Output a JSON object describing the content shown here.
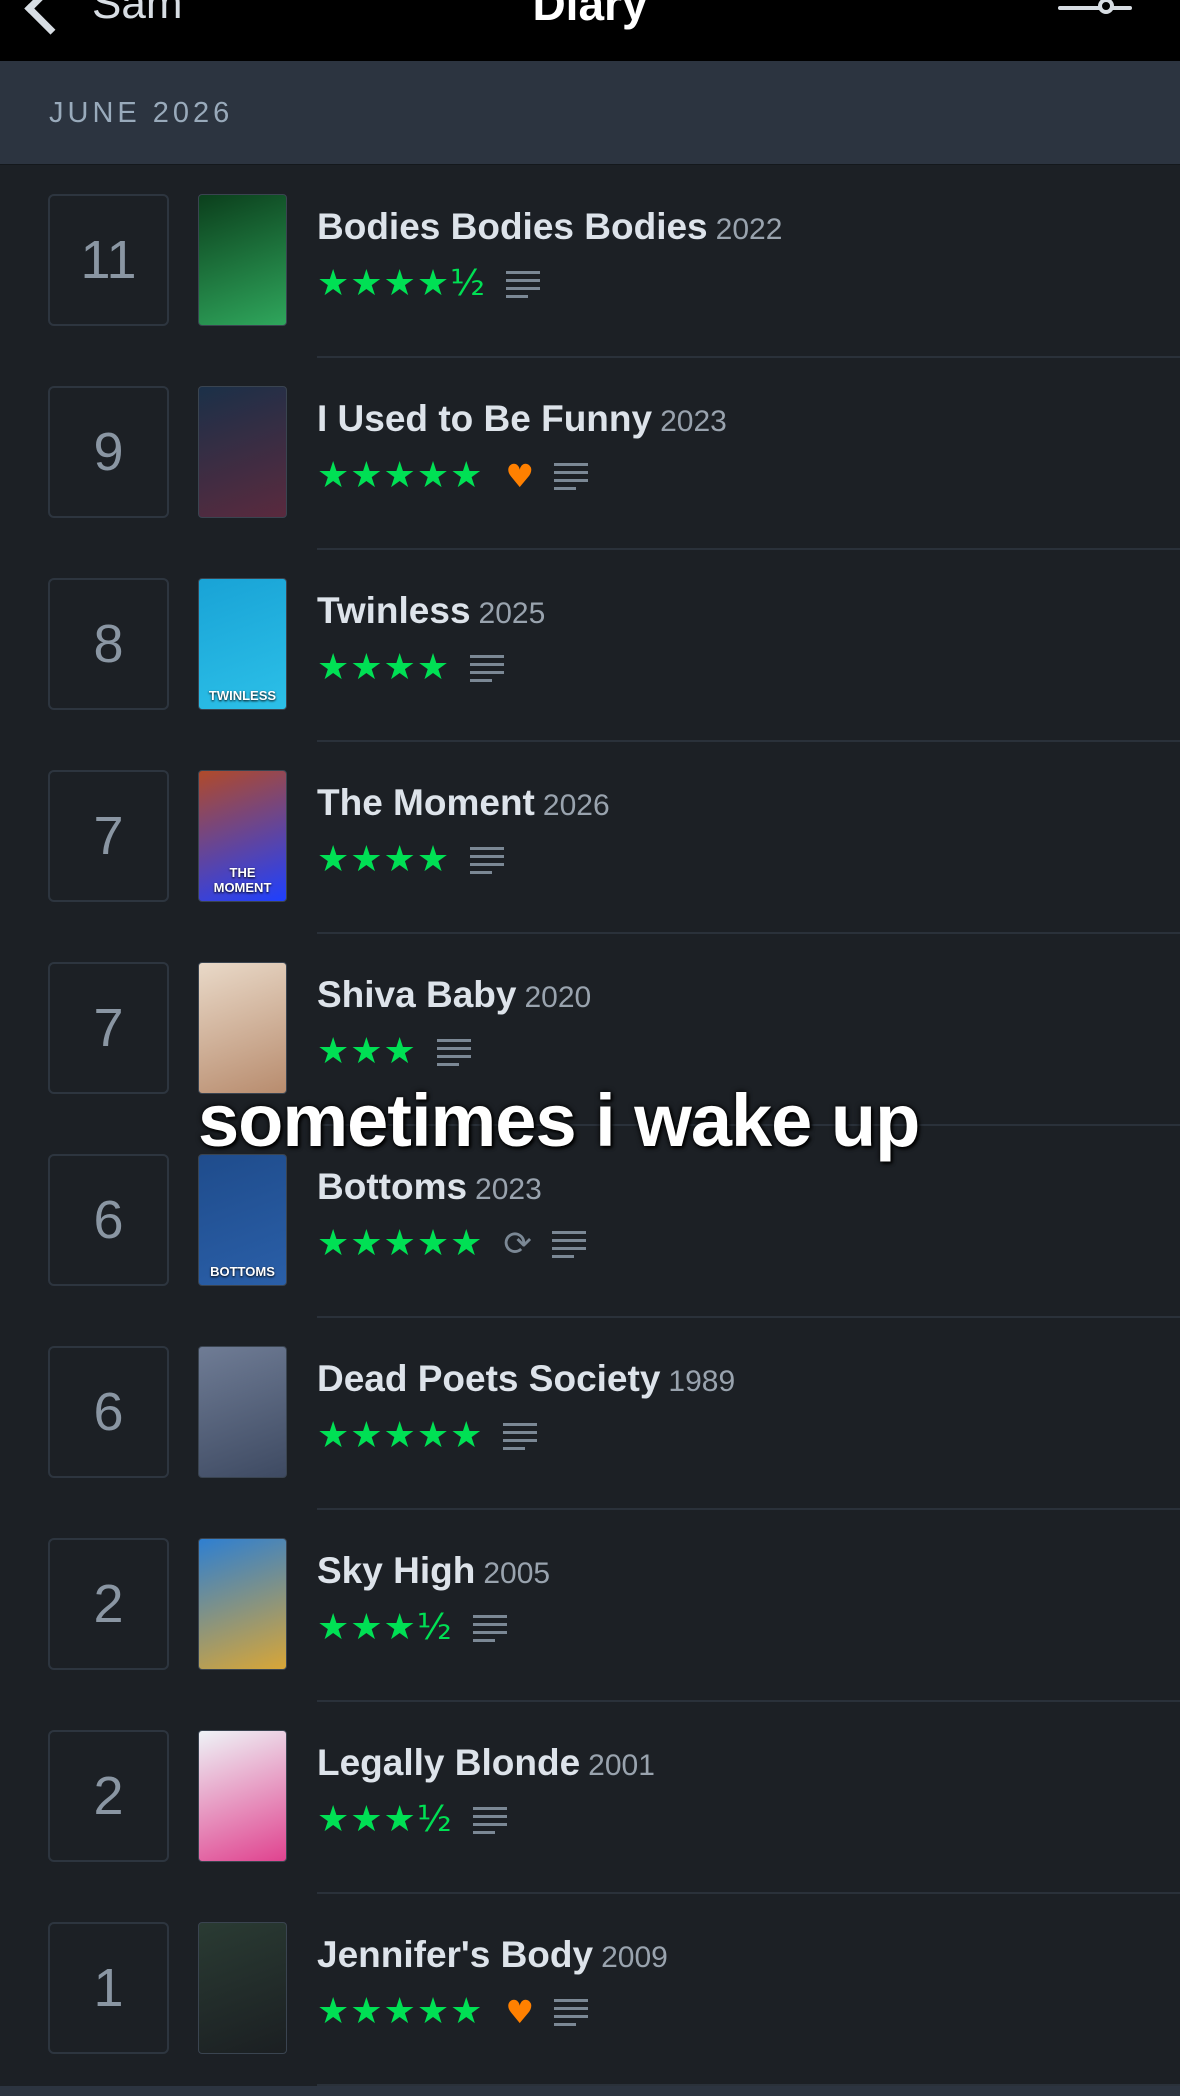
{
  "nav": {
    "back_label": "Sam",
    "title": "Diary"
  },
  "section": {
    "label": "JUNE 2026"
  },
  "caption": "sometimes i wake up",
  "colors": {
    "star": "#00e054",
    "heart": "#ff8000",
    "background": "#1c2025",
    "section": "#2c3440"
  },
  "entries": [
    {
      "day": "11",
      "title": "Bodies Bodies Bodies",
      "year": "2022",
      "stars": "★★★★½",
      "rating": 4.5,
      "liked": false,
      "rewatch": false,
      "review": true,
      "poster_colors": [
        "#0b3f1c",
        "#2fa65c"
      ],
      "poster_text": ""
    },
    {
      "day": "9",
      "title": "I Used to Be Funny",
      "year": "2023",
      "stars": "★★★★★",
      "rating": 5,
      "liked": true,
      "rewatch": false,
      "review": true,
      "poster_colors": [
        "#1b3048",
        "#5a2a3e"
      ],
      "poster_text": ""
    },
    {
      "day": "8",
      "title": "Twinless",
      "year": "2025",
      "stars": "★★★★",
      "rating": 4,
      "liked": false,
      "rewatch": false,
      "review": true,
      "poster_colors": [
        "#19a3d6",
        "#2cc0e8"
      ],
      "poster_text": "TWINLESS"
    },
    {
      "day": "7",
      "title": "The Moment",
      "year": "2026",
      "stars": "★★★★",
      "rating": 4,
      "liked": false,
      "rewatch": false,
      "review": true,
      "poster_colors": [
        "#b04a2a",
        "#1e40ff"
      ],
      "poster_text": "THE MOMENT"
    },
    {
      "day": "7",
      "title": "Shiva Baby",
      "year": "2020",
      "stars": "★★★",
      "rating": 3,
      "liked": false,
      "rewatch": false,
      "review": true,
      "poster_colors": [
        "#e9d9c8",
        "#b88c6e"
      ],
      "poster_text": ""
    },
    {
      "day": "6",
      "title": "Bottoms",
      "year": "2023",
      "stars": "★★★★★",
      "rating": 5,
      "liked": false,
      "rewatch": true,
      "review": true,
      "poster_colors": [
        "#1f4c8c",
        "#2a5fa8"
      ],
      "poster_text": "BOTTOMS"
    },
    {
      "day": "6",
      "title": "Dead Poets Society",
      "year": "1989",
      "stars": "★★★★★",
      "rating": 5,
      "liked": false,
      "rewatch": false,
      "review": true,
      "poster_colors": [
        "#6f7c95",
        "#3e4a62"
      ],
      "poster_text": ""
    },
    {
      "day": "2",
      "title": "Sky High",
      "year": "2005",
      "stars": "★★★½",
      "rating": 3.5,
      "liked": false,
      "rewatch": false,
      "review": true,
      "poster_colors": [
        "#2e7fd1",
        "#d8a637"
      ],
      "poster_text": ""
    },
    {
      "day": "2",
      "title": "Legally Blonde",
      "year": "2001",
      "stars": "★★★½",
      "rating": 3.5,
      "liked": false,
      "rewatch": false,
      "review": true,
      "poster_colors": [
        "#eef3f7",
        "#e0438f"
      ],
      "poster_text": ""
    },
    {
      "day": "1",
      "title": "Jennifer's Body",
      "year": "2009",
      "stars": "★★★★★",
      "rating": 5,
      "liked": true,
      "rewatch": false,
      "review": true,
      "poster_colors": [
        "#2a3b33",
        "#1b1f22"
      ],
      "poster_text": ""
    }
  ]
}
